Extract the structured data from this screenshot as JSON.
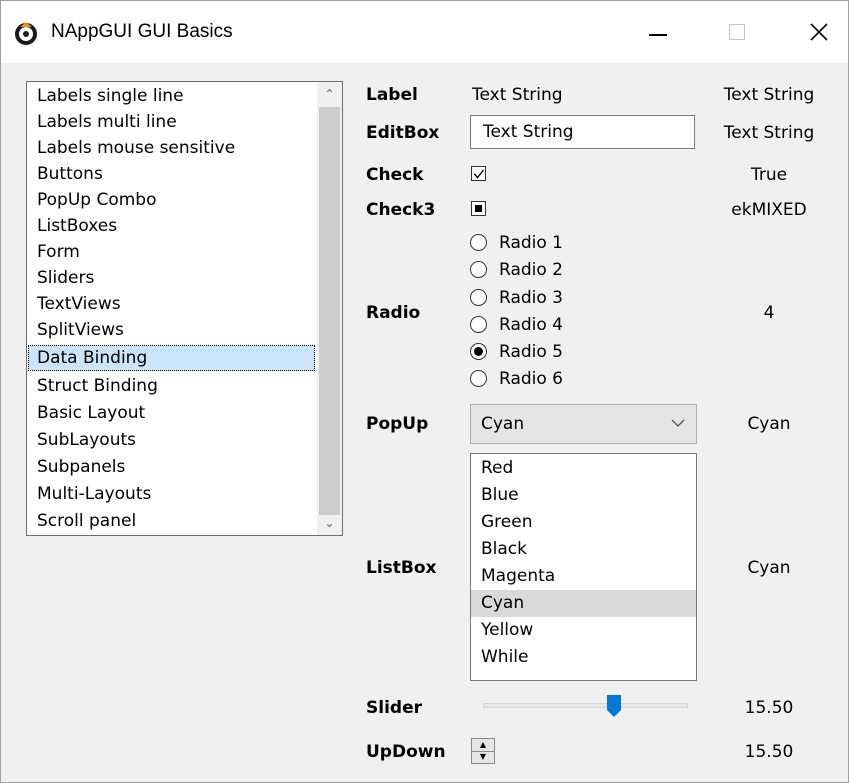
{
  "window": {
    "title": "NAppGUI GUI Basics",
    "accent": "#0078d7"
  },
  "demo_list": {
    "items": [
      "Labels single line",
      "Labels multi line",
      "Labels mouse sensitive",
      "Buttons",
      "PopUp Combo",
      "ListBoxes",
      "Form",
      "Sliders",
      "TextViews",
      "SplitViews",
      "Data Binding",
      "Struct Binding",
      "Basic Layout",
      "SubLayouts",
      "Subpanels",
      "Multi-Layouts",
      "Scroll panel"
    ],
    "selected_index": 10,
    "selected_color": "#cce4f7"
  },
  "form": {
    "label": {
      "label": "Label",
      "text": "Text String",
      "value": "Text String"
    },
    "editbox": {
      "label": "EditBox",
      "text": "Text String",
      "value": "Text String"
    },
    "check": {
      "label": "Check",
      "state": "checked",
      "value": "True"
    },
    "check3": {
      "label": "Check3",
      "state": "mixed",
      "value": "ekMIXED"
    },
    "radio": {
      "label": "Radio",
      "options": [
        "Radio 1",
        "Radio 2",
        "Radio 3",
        "Radio 4",
        "Radio 5",
        "Radio 6"
      ],
      "selected_index": 4,
      "value": "4"
    },
    "popup": {
      "label": "PopUp",
      "selected": "Cyan",
      "value": "Cyan"
    },
    "listbox": {
      "label": "ListBox",
      "items": [
        "Red",
        "Blue",
        "Green",
        "Black",
        "Magenta",
        "Cyan",
        "Yellow",
        "While"
      ],
      "selected_index": 5,
      "value": "Cyan"
    },
    "slider": {
      "label": "Slider",
      "position_fraction": 0.64,
      "value": "15.50"
    },
    "updown": {
      "label": "UpDown",
      "value": "15.50"
    }
  }
}
